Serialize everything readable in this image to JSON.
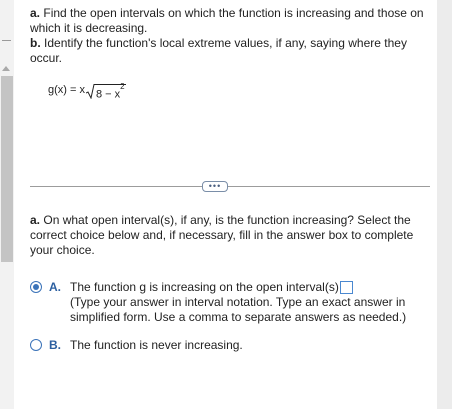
{
  "problem": {
    "part_a_label": "a.",
    "part_a_text": "Find the open intervals on which the function is increasing and those on which it is decreasing.",
    "part_b_label": "b.",
    "part_b_text": "Identify the function's local extreme values, if any, saying where they occur.",
    "function_lhs": "g(x) = x",
    "radicand": "8 − x",
    "exponent": "2"
  },
  "expand_button_label": "•••",
  "question": {
    "label": "a.",
    "text": "On what open interval(s), if any, is the function increasing? Select the correct choice below and, if necessary, fill in the answer box to complete your choice."
  },
  "choices": [
    {
      "letter": "A.",
      "selected": true,
      "text": "The function g is increasing on the open interval(s)",
      "answer_value": "",
      "hint": "(Type your answer in interval notation. Type an exact answer in simplified form. Use a comma to separate answers as needed.)"
    },
    {
      "letter": "B.",
      "selected": false,
      "text": "The function is never increasing."
    }
  ],
  "colors": {
    "accent": "#3b73b9",
    "choice_letter": "#2c5fa0",
    "divider": "#9c9c9c"
  }
}
